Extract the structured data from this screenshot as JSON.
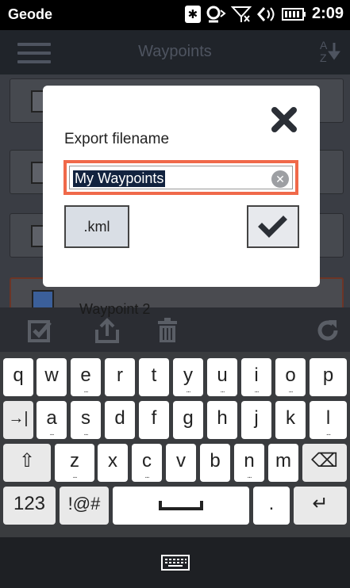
{
  "status_bar": {
    "app_name": "Geode",
    "time": "2:09",
    "icons": [
      "bluetooth-icon",
      "gps-icon",
      "signal-icon",
      "volume-icon",
      "battery-icon"
    ]
  },
  "app_bar": {
    "title": "Waypoints",
    "menu_icon": "hamburger-icon",
    "sort_icon": "sort-az-icon",
    "sort_letters": [
      "A",
      "Z"
    ]
  },
  "list": {
    "visible_item_label": "Waypoint 2",
    "checked_states": [
      true,
      true,
      false,
      true
    ]
  },
  "dialog": {
    "label": "Export filename",
    "filename_value": "My Waypoints",
    "extension_button": ".kml",
    "close_icon": "close-icon",
    "clear_icon": "clear-text-icon",
    "confirm_icon": "checkmark-icon",
    "accent_color": "#f0694a"
  },
  "toolbar": {
    "icons": [
      "select-all-icon",
      "upload-icon",
      "delete-icon",
      "refresh-icon"
    ]
  },
  "keyboard": {
    "row1": [
      "q",
      "w",
      "e",
      "r",
      "t",
      "y",
      "u",
      "i",
      "o",
      "p"
    ],
    "row2": [
      "→|",
      "a",
      "s",
      "d",
      "f",
      "g",
      "h",
      "j",
      "k",
      "l"
    ],
    "row3": [
      "⇧",
      "z",
      "x",
      "c",
      "v",
      "b",
      "n",
      "m",
      "⌫"
    ],
    "row4": [
      "123",
      "!@#",
      "space",
      ".",
      "↵"
    ],
    "dots_keys": [
      "e",
      "y",
      "u",
      "i",
      "o",
      "a",
      "s",
      "l",
      "z",
      "c",
      "n"
    ]
  }
}
